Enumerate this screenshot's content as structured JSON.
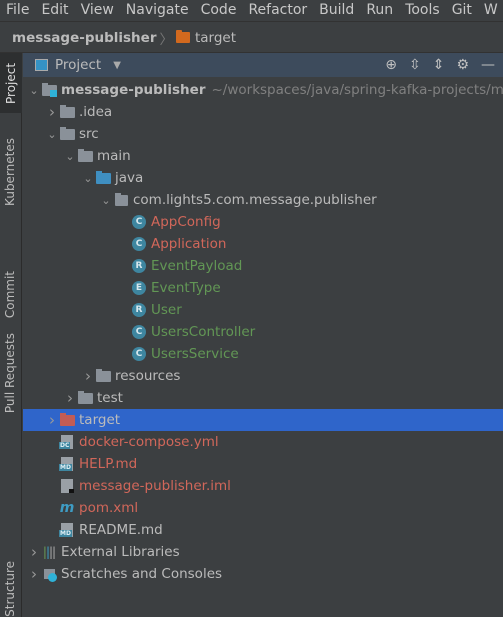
{
  "menu": [
    "File",
    "Edit",
    "View",
    "Navigate",
    "Code",
    "Refactor",
    "Build",
    "Run",
    "Tools",
    "Git",
    "W"
  ],
  "breadcrumb": {
    "project": "message-publisher",
    "folder": "target"
  },
  "side_tabs": [
    "Project",
    "Kubernetes",
    "Commit",
    "Pull Requests",
    "Structure"
  ],
  "panel": {
    "title": "Project"
  },
  "tree": [
    {
      "label": "message-publisher",
      "path": "~/workspaces/java/spring-kafka-projects/m",
      "level": 0,
      "chev": "open",
      "icon": "module",
      "color": "bold"
    },
    {
      "label": ".idea",
      "level": 1,
      "chev": "closed",
      "icon": "folder"
    },
    {
      "label": "src",
      "level": 1,
      "chev": "open",
      "icon": "folder"
    },
    {
      "label": "main",
      "level": 2,
      "chev": "open",
      "icon": "folder"
    },
    {
      "label": "java",
      "level": 3,
      "chev": "open",
      "icon": "source-folder"
    },
    {
      "label": "com.lights5.com.message.publisher",
      "level": 4,
      "chev": "open",
      "icon": "package"
    },
    {
      "label": "AppConfig",
      "level": 5,
      "icon": "class",
      "glyph": "C",
      "color": "red"
    },
    {
      "label": "Application",
      "level": 5,
      "icon": "class",
      "glyph": "C",
      "color": "red"
    },
    {
      "label": "EventPayload",
      "level": 5,
      "icon": "record",
      "glyph": "R",
      "color": "green"
    },
    {
      "label": "EventType",
      "level": 5,
      "icon": "enum",
      "glyph": "E",
      "color": "green"
    },
    {
      "label": "User",
      "level": 5,
      "icon": "record",
      "glyph": "R",
      "color": "green"
    },
    {
      "label": "UsersController",
      "level": 5,
      "icon": "class",
      "glyph": "C",
      "color": "green"
    },
    {
      "label": "UsersService",
      "level": 5,
      "icon": "class",
      "glyph": "C",
      "color": "green"
    },
    {
      "label": "resources",
      "level": 3,
      "chev": "closed",
      "icon": "folder"
    },
    {
      "label": "test",
      "level": 2,
      "chev": "closed",
      "icon": "folder"
    },
    {
      "label": "target",
      "level": 1,
      "chev": "closed",
      "icon": "excluded-folder",
      "selected": true
    },
    {
      "label": "docker-compose.yml",
      "level": 1,
      "icon": "file",
      "badge": "DC",
      "color": "red"
    },
    {
      "label": "HELP.md",
      "level": 1,
      "icon": "file",
      "badge": "MD",
      "color": "red"
    },
    {
      "label": "message-publisher.iml",
      "level": 1,
      "icon": "file",
      "color": "red"
    },
    {
      "label": "pom.xml",
      "level": 1,
      "icon": "maven",
      "color": "red"
    },
    {
      "label": "README.md",
      "level": 1,
      "icon": "file",
      "badge": "MD"
    },
    {
      "label": "External Libraries",
      "level": 0,
      "chev": "closed",
      "icon": "libraries"
    },
    {
      "label": "Scratches and Consoles",
      "level": 0,
      "chev": "closed",
      "icon": "scratches"
    }
  ],
  "colors": {
    "selection": "#2f65ca",
    "unversioned": "#d1675a",
    "added": "#629755",
    "header": "#3d4b5c"
  }
}
